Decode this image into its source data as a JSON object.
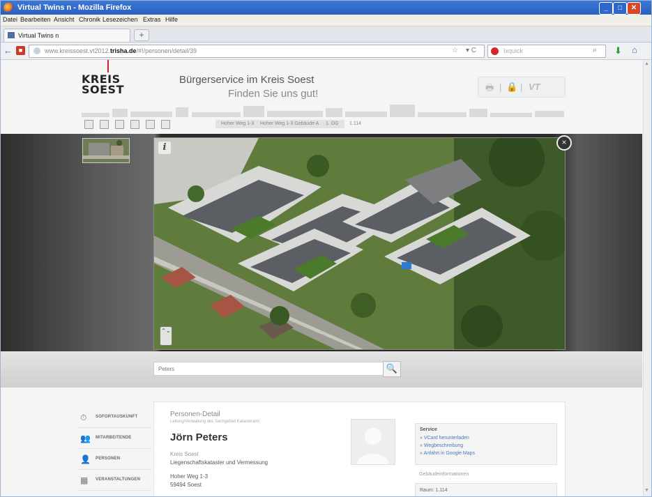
{
  "window": {
    "title": "Virtual Twins n - Mozilla Firefox",
    "controls": [
      "_",
      "□",
      "✕"
    ]
  },
  "menu": [
    "Datei",
    "Bearbeiten",
    "Ansicht",
    "Chronik",
    "Lesezeichen",
    "Extras",
    "Hilfe"
  ],
  "tabs": [
    {
      "label": "Virtual Twins n"
    }
  ],
  "newtab_label": "+",
  "nav": {
    "back_icon": "←",
    "url_prefix": "www.kreissoest.vt2012.",
    "url_bold": "trisha.de",
    "url_suffix": "/#!/personen/detail/39",
    "search_placeholder": "Ixquick",
    "reload_icon": "▾ C"
  },
  "header": {
    "logo_line1": "KREIS",
    "logo_line2": "SOEST",
    "title": "Bürgerservice im Kreis Soest",
    "slogan": "Finden Sie uns gut!",
    "tools": [
      "🖶",
      "|",
      "🔒",
      "|",
      "VT"
    ]
  },
  "breadcrumbs": [
    "Hoher Weg 1-3",
    "Hoher Weg 1-3 Gebäude A",
    "1. OG",
    "1.114"
  ],
  "viewer": {
    "info_label": "i",
    "close_label": "×",
    "nav_label": "⌃⌄"
  },
  "search": {
    "value": "Peters",
    "button_icon": "🔍"
  },
  "sidemenu": [
    {
      "icon": "⏱",
      "label": "SOFORTAUSKUNFT"
    },
    {
      "icon": "👥",
      "label": "MITARBEITENDE"
    },
    {
      "icon": "👤",
      "label": "PERSONEN"
    },
    {
      "icon": "▦",
      "label": "VERANSTALTUNGEN"
    }
  ],
  "person": {
    "heading": "Personen-Detail",
    "subheading": "Leitung/Verwaltung des Sachgebiet Katasteramt",
    "name": "Jörn Peters",
    "org": "Kreis Soest",
    "dept": "Liegenschaftskataster und Vermessung",
    "street": "Hoher Weg 1-3",
    "city": "59494 Soest"
  },
  "service": {
    "heading": "Service",
    "links": [
      "» VCard herunterladen",
      "» Wegbeschreibung",
      "» Anfahrt in Google Maps"
    ]
  },
  "more_info": "Gebäudeinformationen",
  "room": "Raum: 1.114"
}
